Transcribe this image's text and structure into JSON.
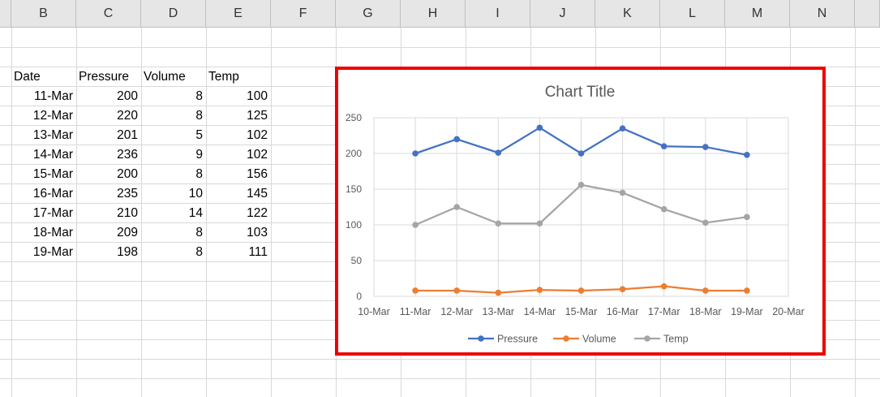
{
  "columns": [
    "B",
    "C",
    "D",
    "E",
    "F",
    "G",
    "H",
    "I",
    "J",
    "K",
    "L",
    "M",
    "N"
  ],
  "table": {
    "headers": [
      "Date",
      "Pressure",
      "Volume",
      "Temp"
    ],
    "rows": [
      [
        "11-Mar",
        "200",
        "8",
        "100"
      ],
      [
        "12-Mar",
        "220",
        "8",
        "125"
      ],
      [
        "13-Mar",
        "201",
        "5",
        "102"
      ],
      [
        "14-Mar",
        "236",
        "9",
        "102"
      ],
      [
        "15-Mar",
        "200",
        "8",
        "156"
      ],
      [
        "16-Mar",
        "235",
        "10",
        "145"
      ],
      [
        "17-Mar",
        "210",
        "14",
        "122"
      ],
      [
        "18-Mar",
        "209",
        "8",
        "103"
      ],
      [
        "19-Mar",
        "198",
        "8",
        "111"
      ]
    ]
  },
  "colors": {
    "highlight_border": "#ee0000",
    "pressure": "#4472c4",
    "volume": "#ed7d31",
    "temp": "#a5a5a5"
  },
  "chart_data": {
    "type": "line",
    "title": "Chart Title",
    "x": [
      "11-Mar",
      "12-Mar",
      "13-Mar",
      "14-Mar",
      "15-Mar",
      "16-Mar",
      "17-Mar",
      "18-Mar",
      "19-Mar"
    ],
    "x_ticks": [
      "10-Mar",
      "11-Mar",
      "12-Mar",
      "13-Mar",
      "14-Mar",
      "15-Mar",
      "16-Mar",
      "17-Mar",
      "18-Mar",
      "19-Mar",
      "20-Mar"
    ],
    "ylim": [
      0,
      250
    ],
    "y_ticks": [
      0,
      50,
      100,
      150,
      200,
      250
    ],
    "grid": true,
    "legend": "bottom",
    "series": [
      {
        "name": "Pressure",
        "color": "#4472c4",
        "values": [
          200,
          220,
          201,
          236,
          200,
          235,
          210,
          209,
          198
        ]
      },
      {
        "name": "Volume",
        "color": "#ed7d31",
        "values": [
          8,
          8,
          5,
          9,
          8,
          10,
          14,
          8,
          8
        ]
      },
      {
        "name": "Temp",
        "color": "#a5a5a5",
        "values": [
          100,
          125,
          102,
          102,
          156,
          145,
          122,
          103,
          111
        ]
      }
    ]
  }
}
